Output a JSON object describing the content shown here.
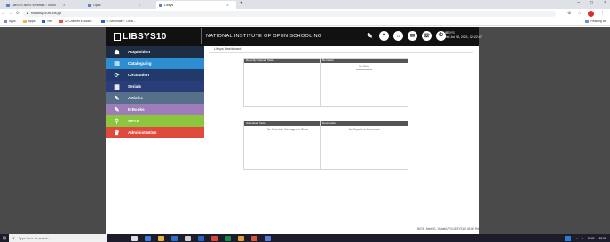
{
  "browser": {
    "tabs": [
      {
        "label": "LIBSYS NIOS Webmail :: Inbox",
        "active": false
      },
      {
        "label": "Opac",
        "active": false
      },
      {
        "label": "Libsys",
        "active": true
      }
    ],
    "new_tab": "+",
    "url": "nioslibsys10/ls1/ls.jsp",
    "bookmarks": [
      {
        "label": "Apps"
      },
      {
        "label": "Apps"
      },
      {
        "label": "nwr"
      },
      {
        "label": "D) Children's Books..."
      },
      {
        "label": "G Secondary : Libra..."
      }
    ],
    "reading_list": "Reading list"
  },
  "header": {
    "logo": "LIBSYS10",
    "title": "NATIONAL INSTITUTE OF OPEN SCHOOLING",
    "icons": [
      {
        "name": "tools-icon",
        "glyph": "✎"
      },
      {
        "name": "help-icon",
        "glyph": "?"
      },
      {
        "name": "home-icon",
        "glyph": "⌂"
      },
      {
        "name": "email-icon",
        "glyph": "✉"
      },
      {
        "name": "chat-icon",
        "glyph": "☏"
      },
      {
        "name": "power-icon",
        "glyph": "⏻"
      }
    ],
    "user": "LIBSYS",
    "datetime": "Wed Jul 28, 2021, 12:22:57"
  },
  "sidebar": {
    "items": [
      {
        "label": "Acquisition",
        "icon": "acquisition-icon",
        "glyph": "☗",
        "color": "#1f2d44"
      },
      {
        "label": "Cataloguing",
        "icon": "cataloguing-icon",
        "glyph": "▤",
        "color": "#2c8ed1"
      },
      {
        "label": "Circulation",
        "icon": "circulation-icon",
        "glyph": "⟳",
        "color": "#223a6b"
      },
      {
        "label": "Serials",
        "icon": "serials-icon",
        "glyph": "▦",
        "color": "#2b3d78"
      },
      {
        "label": "Articles",
        "icon": "articles-icon",
        "glyph": "✎",
        "color": "#56708a"
      },
      {
        "label": "E-Books",
        "icon": "ebooks-icon",
        "glyph": "✎",
        "color": "#9d7cb9"
      },
      {
        "label": "OPAC",
        "icon": "opac-icon",
        "glyph": "⚲",
        "color": "#8cc63f"
      },
      {
        "label": "Administration",
        "icon": "administration-icon",
        "glyph": "♛",
        "color": "#e04a3c"
      }
    ]
  },
  "content": {
    "page_title": "Libsys Dashboard",
    "panels": [
      {
        "title": "Recently Opened Tasks",
        "body": ""
      },
      {
        "title": "Reminder",
        "body": "No Data"
      },
      {
        "title": "Scheduled Tasks",
        "body": "No Schedule Messages to Show"
      },
      {
        "title": "Downloads",
        "body": "No Reports to Download"
      }
    ],
    "status": "NIOS, Sent-01, Vishal(UP) [LIBSYS 10 (8.85) Rel 1.0]"
  },
  "taskbar": {
    "search_placeholder": "Type here to search",
    "tray_text": "ENG",
    "clock": "12:22"
  },
  "colors": {
    "header_bg": "#111111",
    "side_bg": "#4a4a4a",
    "panel_header": "#555555"
  }
}
